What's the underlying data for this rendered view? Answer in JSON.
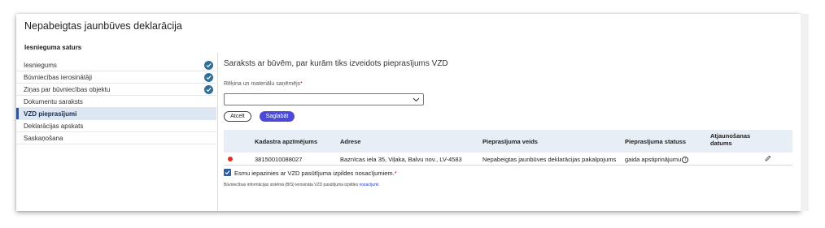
{
  "page": {
    "title": "Nepabeigtas jaunbūves deklarācija",
    "subtitle": "Iesnieguma saturs"
  },
  "sidebar": {
    "items": [
      {
        "label": "Iesniegums",
        "done": true
      },
      {
        "label": "Būvniecības ierosinātāji",
        "done": true
      },
      {
        "label": "Ziņas par būvniecības objektu",
        "done": true
      },
      {
        "label": "Dokumentu saraksts",
        "done": false
      },
      {
        "label": "VZD pieprasījumi",
        "done": false,
        "active": true
      },
      {
        "label": "Deklarācijas apskats",
        "done": false
      },
      {
        "label": "Saskaņošana",
        "done": false
      }
    ]
  },
  "main": {
    "section_title": "Saraksts ar būvēm, par kurām tiks izveidots pieprasījums VZD",
    "field_label": "Rēķina un materiālu saņēmējs",
    "required_mark": "*",
    "select_value": "",
    "cancel_label": "Atcelt",
    "save_label": "Saglabāt"
  },
  "table": {
    "headers": [
      "Kadastra apzīmējums",
      "Adrese",
      "Pieprasījuma veids",
      "Pieprasījuma statuss",
      "Atjaunošanas datums"
    ],
    "rows": [
      {
        "cadastre": "38150010088027",
        "address": "Baznīcas iela 35, Viļaka, Balvu nov., LV-4583",
        "type": "Nepabeigtas jaunbūves deklarācijas pakalpojums",
        "status": "gaida apstiprinājumu",
        "date": ""
      }
    ]
  },
  "agreement": {
    "label": "Esmu iepazinies ar VZD pasūtījuma izpildes nosacījumiem.",
    "required_mark": "*",
    "checked": true,
    "footnote_text": "Būvniecības informācijas sistēmā (BIS) ierosināta VZD pasūtījuma izpildes ",
    "footnote_link": "nosacījumi",
    "footnote_end": "."
  },
  "colors": {
    "accent": "#4b4bd6",
    "check": "#2f6f9a",
    "active_bg": "#dde7f4",
    "table_header_bg": "#e8eef5",
    "error_dot": "#d9342b"
  }
}
